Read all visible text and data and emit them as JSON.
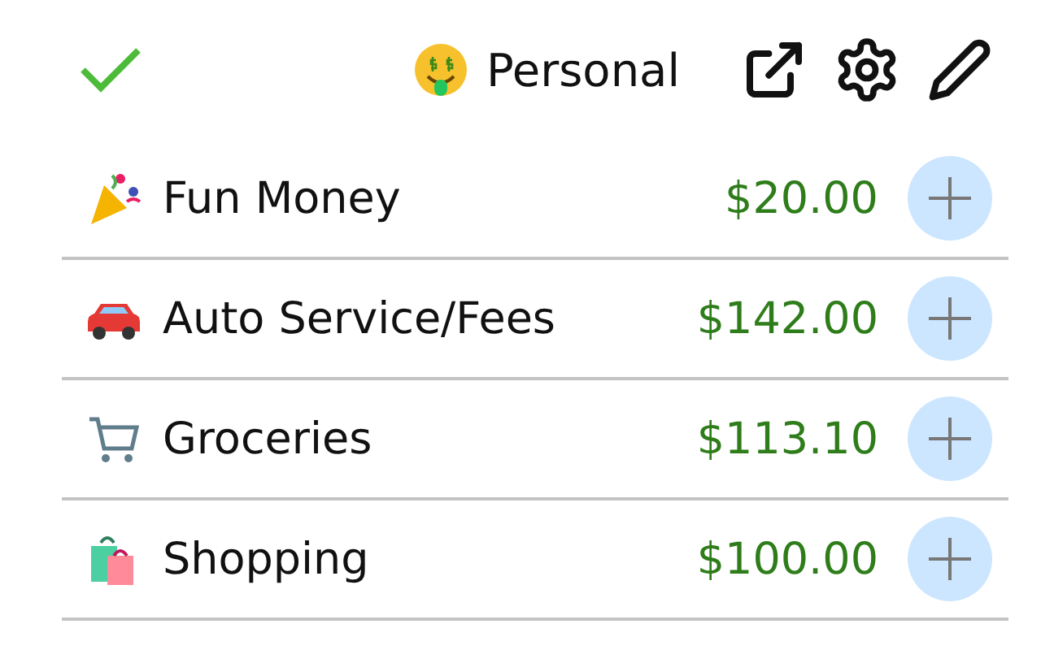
{
  "header": {
    "done": true,
    "account": "Personal"
  },
  "categories": [
    {
      "kind": "party",
      "name": "Fun Money",
      "amount": "$20.00"
    },
    {
      "kind": "car",
      "name": "Auto Service/Fees",
      "amount": "$142.00"
    },
    {
      "kind": "cart",
      "name": "Groceries",
      "amount": "$113.10"
    },
    {
      "kind": "bag",
      "name": "Shopping",
      "amount": "$100.00"
    }
  ]
}
